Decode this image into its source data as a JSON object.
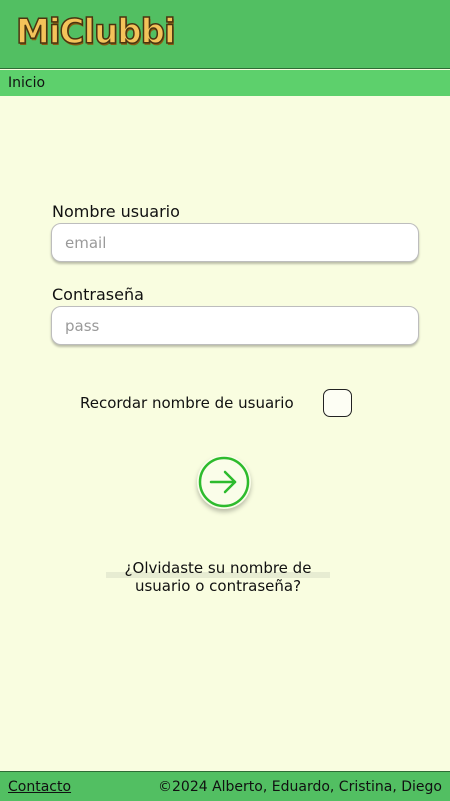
{
  "header": {
    "logo_text": "MiClubbi"
  },
  "nav": {
    "home_label": "Inicio"
  },
  "login": {
    "username_label": "Nombre usuario",
    "username_placeholder": "email",
    "password_label": "Contraseña",
    "password_placeholder": "pass",
    "remember_label": "Recordar nombre de usuario",
    "remember_checked": false,
    "submit_icon": "arrow-right-circle-icon",
    "forgot_text": "¿Olvidaste su nombre de usuario o contraseña?"
  },
  "footer": {
    "contact_label": "Contacto",
    "copyright": "©2024 Alberto, Eduardo, Cristina, Diego"
  },
  "colors": {
    "header_bg": "#52bf62",
    "nav_bg": "#5dd06c",
    "page_bg": "#f9fde0",
    "logo": "#f4c35a",
    "accent": "#2dbb2d"
  }
}
